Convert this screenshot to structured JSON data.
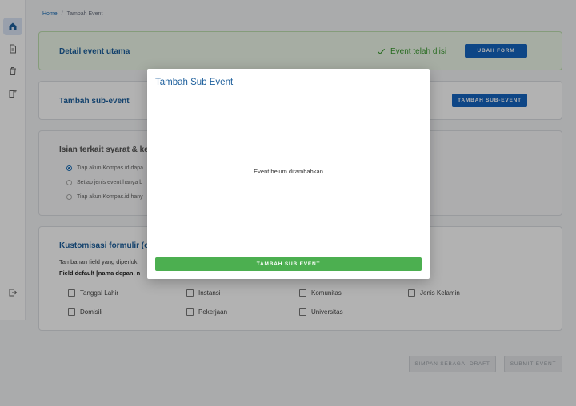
{
  "breadcrumb": {
    "home": "Home",
    "separator": "/",
    "current": "Tambah Event"
  },
  "sidebar": {
    "items": [
      {
        "icon": "home-icon"
      },
      {
        "icon": "document-icon"
      },
      {
        "icon": "trash-icon"
      },
      {
        "icon": "add-document-icon"
      },
      {
        "icon": "logout-icon"
      }
    ]
  },
  "detail": {
    "title": "Detail event utama",
    "status": "Event telah diisi",
    "button": "UBAH FORM"
  },
  "subevent": {
    "title": "Tambah sub-event",
    "button": "TAMBAH SUB-EVENT"
  },
  "syarat": {
    "title": "Isian terkait syarat & ket",
    "options": [
      "Tiap akun Kompas.id dapa",
      "Setiap jenis event hanya b",
      "Tiap akun Kompas.id hany"
    ]
  },
  "kustom": {
    "title": "Kustomisasi formulir (op",
    "desc": "Tambahan field yang diperluk",
    "default": "Field default [nama depan, n",
    "fields": [
      "Tanggal Lahir",
      "Instansi",
      "Komunitas",
      "Jenis Kelamin",
      "Domisili",
      "Pekerjaan",
      "Universitas"
    ]
  },
  "actions": {
    "draft": "SIMPAN SEBAGAI DRAFT",
    "submit": "SUBMIT EVENT"
  },
  "modal": {
    "title": "Tambah Sub Event",
    "empty": "Event belum ditambahkan",
    "button": "TAMBAH SUB EVENT"
  },
  "colors": {
    "primary": "#1565c0",
    "success": "#4caf50",
    "status_green": "#3a9a2e"
  }
}
